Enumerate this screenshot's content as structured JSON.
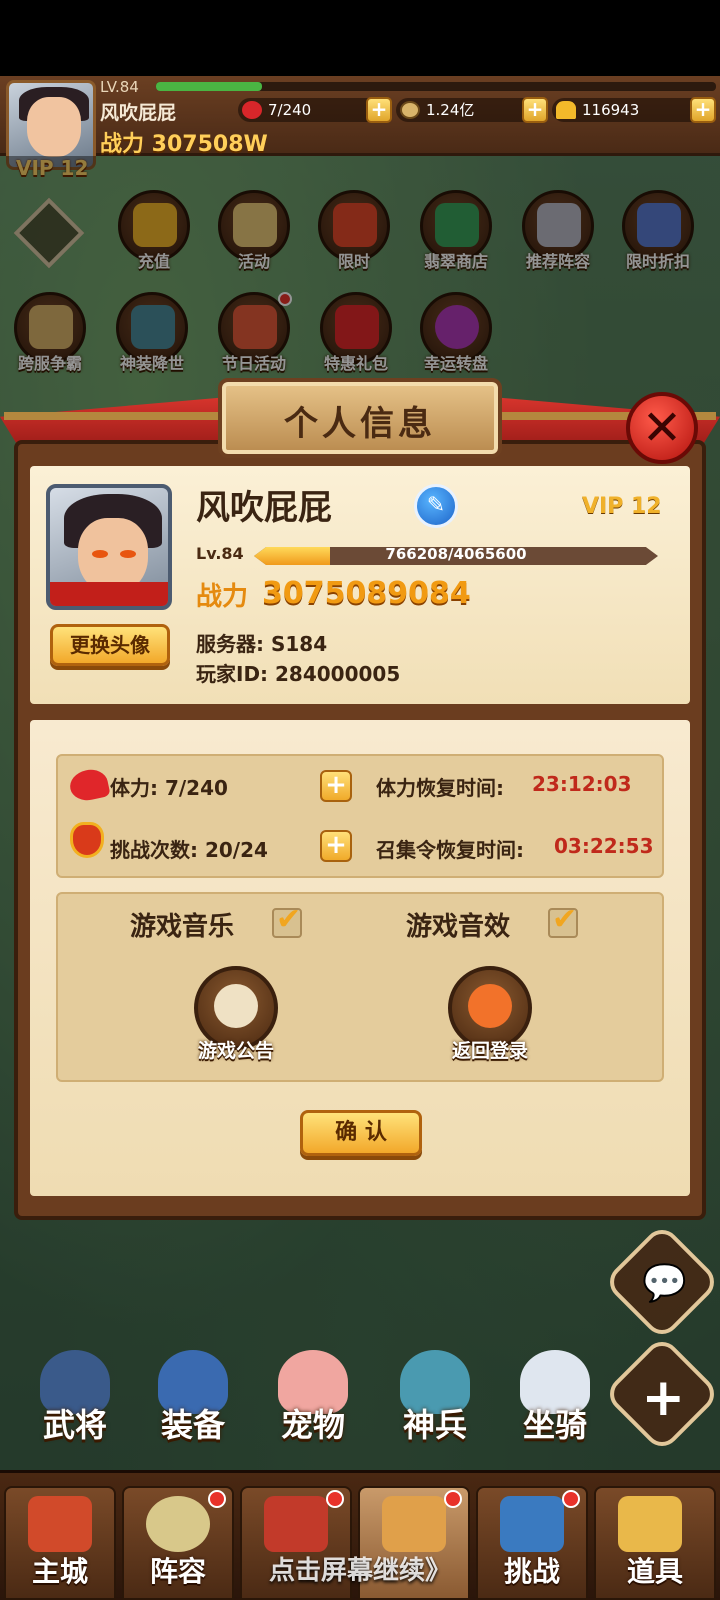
{
  "hud": {
    "level": "LV.84",
    "exp_fraction": 0.19,
    "name": "风吹屁屁",
    "power": "战力 307508W",
    "vip": "VIP 12",
    "stamina": "7/240",
    "coins": "1.24亿",
    "ingots": "116943"
  },
  "activities": [
    {
      "label": "充值"
    },
    {
      "label": "活动"
    },
    {
      "label": "限时"
    },
    {
      "label": "翡翠商店"
    },
    {
      "label": "推荐阵容"
    },
    {
      "label": "限时折扣"
    },
    {
      "label": "跨服争霸"
    },
    {
      "label": "神装降世"
    },
    {
      "label": "节日活动"
    },
    {
      "label": "特惠礼包"
    },
    {
      "label": "幸运转盘"
    }
  ],
  "dialog": {
    "title": "个人信息",
    "profile": {
      "name": "风吹屁屁",
      "vip": "VIP 12",
      "level": "Lv.84",
      "exp_text": "766208/4065600",
      "exp_fraction": 0.188,
      "power_label": "战力",
      "power_value": "3075089084",
      "change_avatar": "更换头像",
      "server": "服务器:  S184",
      "player_id": "玩家ID:  284000005"
    },
    "stats": {
      "stamina": "体力: 7/240",
      "stamina_recover_label": "体力恢复时间:",
      "stamina_recover_time": "23:12:03",
      "challenges": "挑战次数: 20/24",
      "summon_recover_label": "召集令恢复时间:",
      "summon_recover_time": "03:22:53"
    },
    "options": {
      "music_label": "游戏音乐",
      "sound_label": "游戏音效",
      "notice_label": "游戏公告",
      "back_login_label": "返回登录"
    },
    "confirm": "确 认"
  },
  "heroes": [
    {
      "label": "武将"
    },
    {
      "label": "装备"
    },
    {
      "label": "宠物"
    },
    {
      "label": "神兵"
    },
    {
      "label": "坐骑"
    }
  ],
  "tabs": [
    {
      "label": "主城"
    },
    {
      "label": "阵容"
    },
    {
      "label": ""
    },
    {
      "label": ""
    },
    {
      "label": "挑战"
    },
    {
      "label": "道具"
    }
  ],
  "continue_text": "点击屏幕继续》",
  "colors": {
    "accent": "#f19a12",
    "red_text": "#c0291b",
    "close": "#d8231a"
  }
}
